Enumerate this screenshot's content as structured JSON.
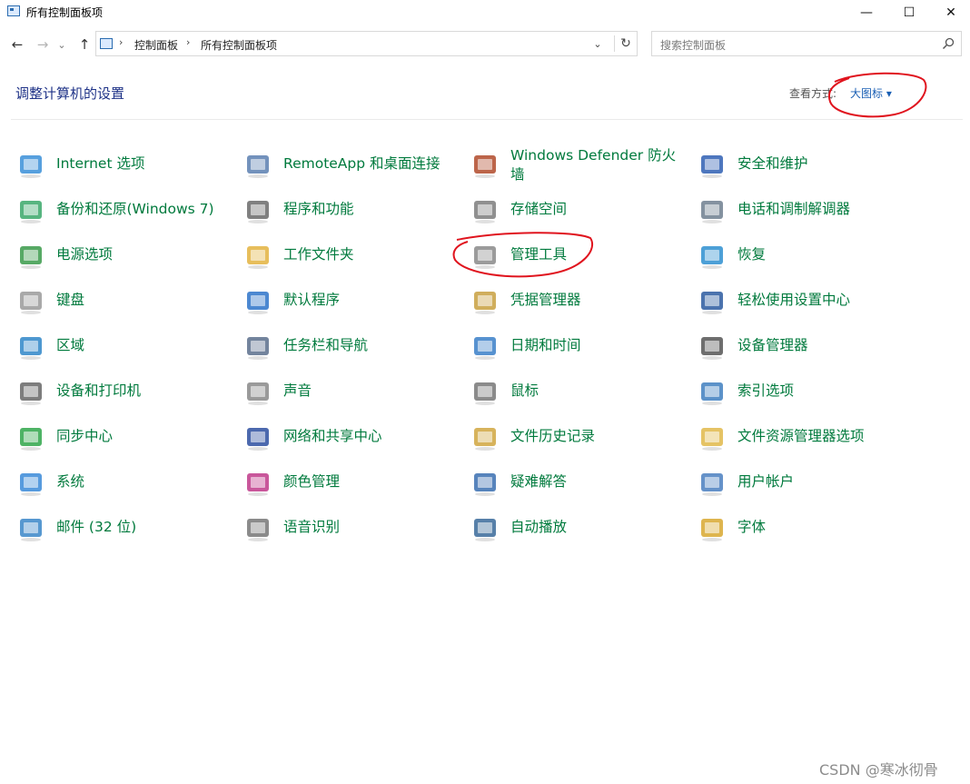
{
  "window": {
    "title": "所有控制面板项",
    "minimize_glyph": "—",
    "maximize_glyph": "☐",
    "close_glyph": "✕"
  },
  "nav": {
    "back_glyph": "←",
    "forward_glyph": "→",
    "recent_glyph": "⌄",
    "up_glyph": "↑"
  },
  "address": {
    "breadcrumbs": [
      "控制面板",
      "所有控制面板项"
    ],
    "separator": "›",
    "dropdown_glyph": "⌄",
    "refresh_glyph": "↻"
  },
  "search": {
    "placeholder": "搜索控制面板"
  },
  "header": {
    "title": "调整计算机的设置",
    "view_by_label": "查看方式:",
    "view_by_value": "大图标 ▾"
  },
  "items": [
    {
      "label": "Internet 选项",
      "icon": "globe-icon"
    },
    {
      "label": "RemoteApp 和桌面连接",
      "icon": "remote-desktop-icon"
    },
    {
      "label": "Windows Defender 防火墙",
      "icon": "firewall-icon"
    },
    {
      "label": "安全和维护",
      "icon": "flag-icon"
    },
    {
      "label": "备份和还原(Windows 7)",
      "icon": "backup-icon"
    },
    {
      "label": "程序和功能",
      "icon": "programs-icon"
    },
    {
      "label": "存储空间",
      "icon": "storage-icon"
    },
    {
      "label": "电话和调制解调器",
      "icon": "phone-icon"
    },
    {
      "label": "电源选项",
      "icon": "battery-icon"
    },
    {
      "label": "工作文件夹",
      "icon": "work-folder-icon"
    },
    {
      "label": "管理工具",
      "icon": "admin-tools-icon"
    },
    {
      "label": "恢复",
      "icon": "recovery-icon"
    },
    {
      "label": "键盘",
      "icon": "keyboard-icon"
    },
    {
      "label": "默认程序",
      "icon": "default-programs-icon"
    },
    {
      "label": "凭据管理器",
      "icon": "credential-icon"
    },
    {
      "label": "轻松使用设置中心",
      "icon": "ease-of-access-icon"
    },
    {
      "label": "区域",
      "icon": "region-icon"
    },
    {
      "label": "任务栏和导航",
      "icon": "taskbar-icon"
    },
    {
      "label": "日期和时间",
      "icon": "calendar-icon"
    },
    {
      "label": "设备管理器",
      "icon": "device-manager-icon"
    },
    {
      "label": "设备和打印机",
      "icon": "printer-icon"
    },
    {
      "label": "声音",
      "icon": "speaker-icon"
    },
    {
      "label": "鼠标",
      "icon": "mouse-icon"
    },
    {
      "label": "索引选项",
      "icon": "indexing-icon"
    },
    {
      "label": "同步中心",
      "icon": "sync-icon"
    },
    {
      "label": "网络和共享中心",
      "icon": "network-icon"
    },
    {
      "label": "文件历史记录",
      "icon": "file-history-icon"
    },
    {
      "label": "文件资源管理器选项",
      "icon": "folder-options-icon"
    },
    {
      "label": "系统",
      "icon": "computer-icon"
    },
    {
      "label": "颜色管理",
      "icon": "color-icon"
    },
    {
      "label": "疑难解答",
      "icon": "troubleshoot-icon"
    },
    {
      "label": "用户帐户",
      "icon": "users-icon"
    },
    {
      "label": "邮件 (32 位)",
      "icon": "mail-icon"
    },
    {
      "label": "语音识别",
      "icon": "microphone-icon"
    },
    {
      "label": "自动播放",
      "icon": "autoplay-icon"
    },
    {
      "label": "字体",
      "icon": "font-icon"
    }
  ],
  "watermark": "CSDN @寒冰彻骨",
  "colors": {
    "link_green": "#007a3d",
    "heading_blue": "#1e3287",
    "annotation_red": "#e0141e"
  }
}
